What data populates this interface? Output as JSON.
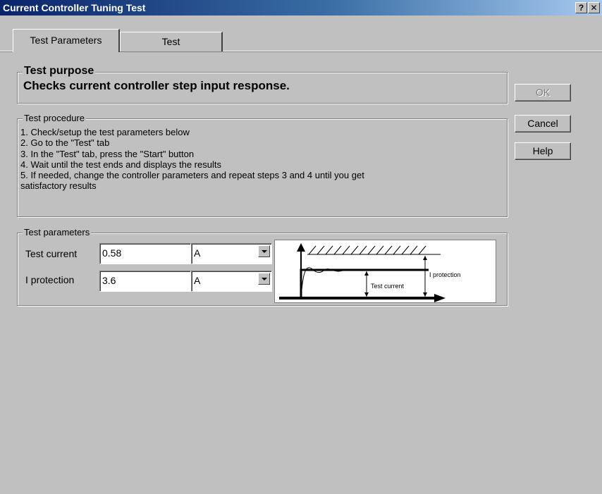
{
  "window": {
    "title": "Current Controller Tuning Test",
    "help_glyph": "?",
    "close_glyph": "✕"
  },
  "tabs": [
    {
      "label": "Test Parameters",
      "active": true
    },
    {
      "label": "Test",
      "active": false
    }
  ],
  "purpose": {
    "legend": "Test purpose",
    "text": "Checks current controller step input response."
  },
  "procedure": {
    "legend": "Test procedure",
    "steps": [
      "1. Check/setup the test parameters below",
      "2. Go to the \"Test\" tab",
      "3. In the \"Test\" tab, press the \"Start\" button",
      "4. Wait until the test ends and displays the results",
      "5. If needed, change the controller parameters and repeat steps 3 and 4 until you get",
      "satisfactory results"
    ]
  },
  "parameters": {
    "legend": "Test parameters",
    "test_current": {
      "label": "Test current",
      "value": "0.58",
      "unit": "A"
    },
    "i_protection": {
      "label": "I protection",
      "value": "3.6",
      "unit": "A"
    },
    "diagram": {
      "i_protection_label": "I protection",
      "test_current_label": "Test current"
    }
  },
  "buttons": {
    "ok": "OK",
    "cancel": "Cancel",
    "help": "Help"
  },
  "colors": {
    "titlebar_start": "#0a246a",
    "titlebar_end": "#a6caf0",
    "face": "#c0c0c0"
  }
}
